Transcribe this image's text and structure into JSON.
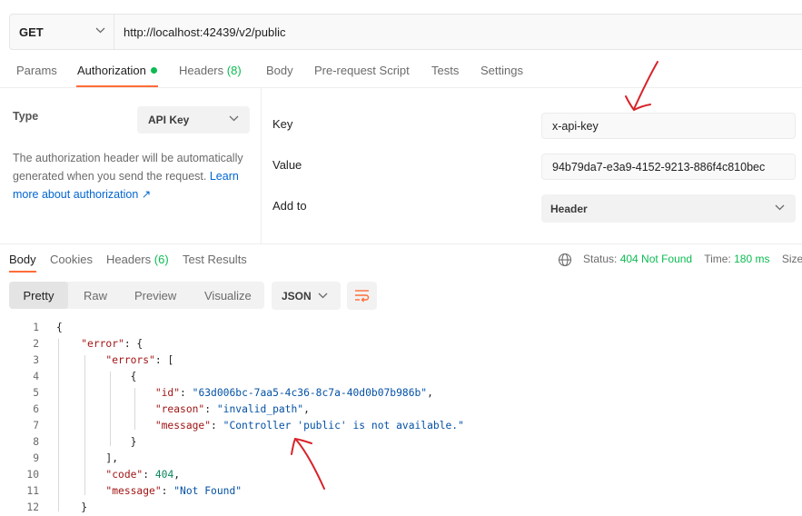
{
  "request": {
    "method": "GET",
    "url": "http://localhost:42439/v2/public"
  },
  "request_tabs": [
    {
      "label": "Params"
    },
    {
      "label": "Authorization"
    },
    {
      "label": "Headers",
      "count": "(8)"
    },
    {
      "label": "Body"
    },
    {
      "label": "Pre-request Script"
    },
    {
      "label": "Tests"
    },
    {
      "label": "Settings"
    }
  ],
  "auth": {
    "type_label": "Type",
    "type_value": "API Key",
    "description": "The authorization header will be automatically generated when you send the request.",
    "learn_more": "Learn more about authorization ↗",
    "key_label": "Key",
    "key_value": "x-api-key",
    "value_label": "Value",
    "value_value": "94b79da7-e3a9-4152-9213-886f4c810bec",
    "addto_label": "Add to",
    "addto_value": "Header"
  },
  "response_tabs": [
    {
      "label": "Body"
    },
    {
      "label": "Cookies"
    },
    {
      "label": "Headers",
      "count": "(6)"
    },
    {
      "label": "Test Results"
    }
  ],
  "status": {
    "status_label": "Status:",
    "status_value": "404 Not Found",
    "time_label": "Time:",
    "time_value": "180 ms",
    "size_label": "Size:"
  },
  "view_buttons": [
    "Pretty",
    "Raw",
    "Preview",
    "Visualize"
  ],
  "format": "JSON",
  "code_lines": [
    {
      "n": "1",
      "parts": [
        {
          "t": "{",
          "c": "p"
        }
      ]
    },
    {
      "n": "2",
      "parts": [
        {
          "t": "    "
        },
        {
          "t": "\"error\"",
          "c": "k"
        },
        {
          "t": ": {",
          "c": "p"
        }
      ]
    },
    {
      "n": "3",
      "parts": [
        {
          "t": "        "
        },
        {
          "t": "\"errors\"",
          "c": "k"
        },
        {
          "t": ": [",
          "c": "p"
        }
      ]
    },
    {
      "n": "4",
      "parts": [
        {
          "t": "            "
        },
        {
          "t": "{",
          "c": "p"
        }
      ]
    },
    {
      "n": "5",
      "parts": [
        {
          "t": "                "
        },
        {
          "t": "\"id\"",
          "c": "k"
        },
        {
          "t": ": ",
          "c": "p"
        },
        {
          "t": "\"63d006bc-7aa5-4c36-8c7a-40d0b07b986b\"",
          "c": "s"
        },
        {
          "t": ",",
          "c": "p"
        }
      ]
    },
    {
      "n": "6",
      "parts": [
        {
          "t": "                "
        },
        {
          "t": "\"reason\"",
          "c": "k"
        },
        {
          "t": ": ",
          "c": "p"
        },
        {
          "t": "\"invalid_path\"",
          "c": "s"
        },
        {
          "t": ",",
          "c": "p"
        }
      ]
    },
    {
      "n": "7",
      "parts": [
        {
          "t": "                "
        },
        {
          "t": "\"message\"",
          "c": "k"
        },
        {
          "t": ": ",
          "c": "p"
        },
        {
          "t": "\"Controller 'public' is not available.\"",
          "c": "s"
        }
      ]
    },
    {
      "n": "8",
      "parts": [
        {
          "t": "            "
        },
        {
          "t": "}",
          "c": "p"
        }
      ]
    },
    {
      "n": "9",
      "parts": [
        {
          "t": "        "
        },
        {
          "t": "],",
          "c": "p"
        }
      ]
    },
    {
      "n": "10",
      "parts": [
        {
          "t": "        "
        },
        {
          "t": "\"code\"",
          "c": "k"
        },
        {
          "t": ": ",
          "c": "p"
        },
        {
          "t": "404",
          "c": "n"
        },
        {
          "t": ",",
          "c": "p"
        }
      ]
    },
    {
      "n": "11",
      "parts": [
        {
          "t": "        "
        },
        {
          "t": "\"message\"",
          "c": "k"
        },
        {
          "t": ": ",
          "c": "p"
        },
        {
          "t": "\"Not Found\"",
          "c": "s"
        }
      ]
    },
    {
      "n": "12",
      "parts": [
        {
          "t": "    "
        },
        {
          "t": "}",
          "c": "p"
        }
      ]
    }
  ],
  "colors": {
    "accent": "#ff6c37",
    "green": "#0cbb52",
    "link": "#0265d2",
    "annotation": "#d8232a"
  }
}
